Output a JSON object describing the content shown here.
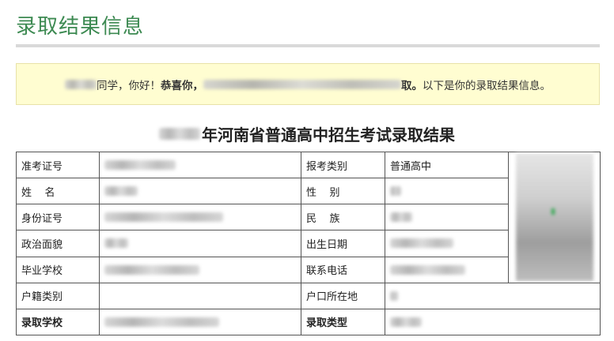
{
  "page": {
    "title": "录取结果信息"
  },
  "notice": {
    "part1": "同学，你好！",
    "congrats": "恭喜你，",
    "admitted_suffix": "取。",
    "part2": "以下是你的录取结果信息。"
  },
  "result": {
    "title_suffix": "年河南省普通高中招生考试录取结果"
  },
  "table": {
    "exam_no_label": "准考证号",
    "category_label": "报考类别",
    "category_value": "普通高中",
    "name_label": "姓    名",
    "gender_label": "性    别",
    "id_label": "身份证号",
    "ethnicity_label": "民    族",
    "political_label": "政治面貌",
    "birth_label": "出生日期",
    "school_label": "毕业学校",
    "phone_label": "联系电话",
    "household_type_label": "户籍类别",
    "household_location_label": "户口所在地",
    "admitted_school_label": "录取学校",
    "admission_type_label": "录取类型"
  }
}
